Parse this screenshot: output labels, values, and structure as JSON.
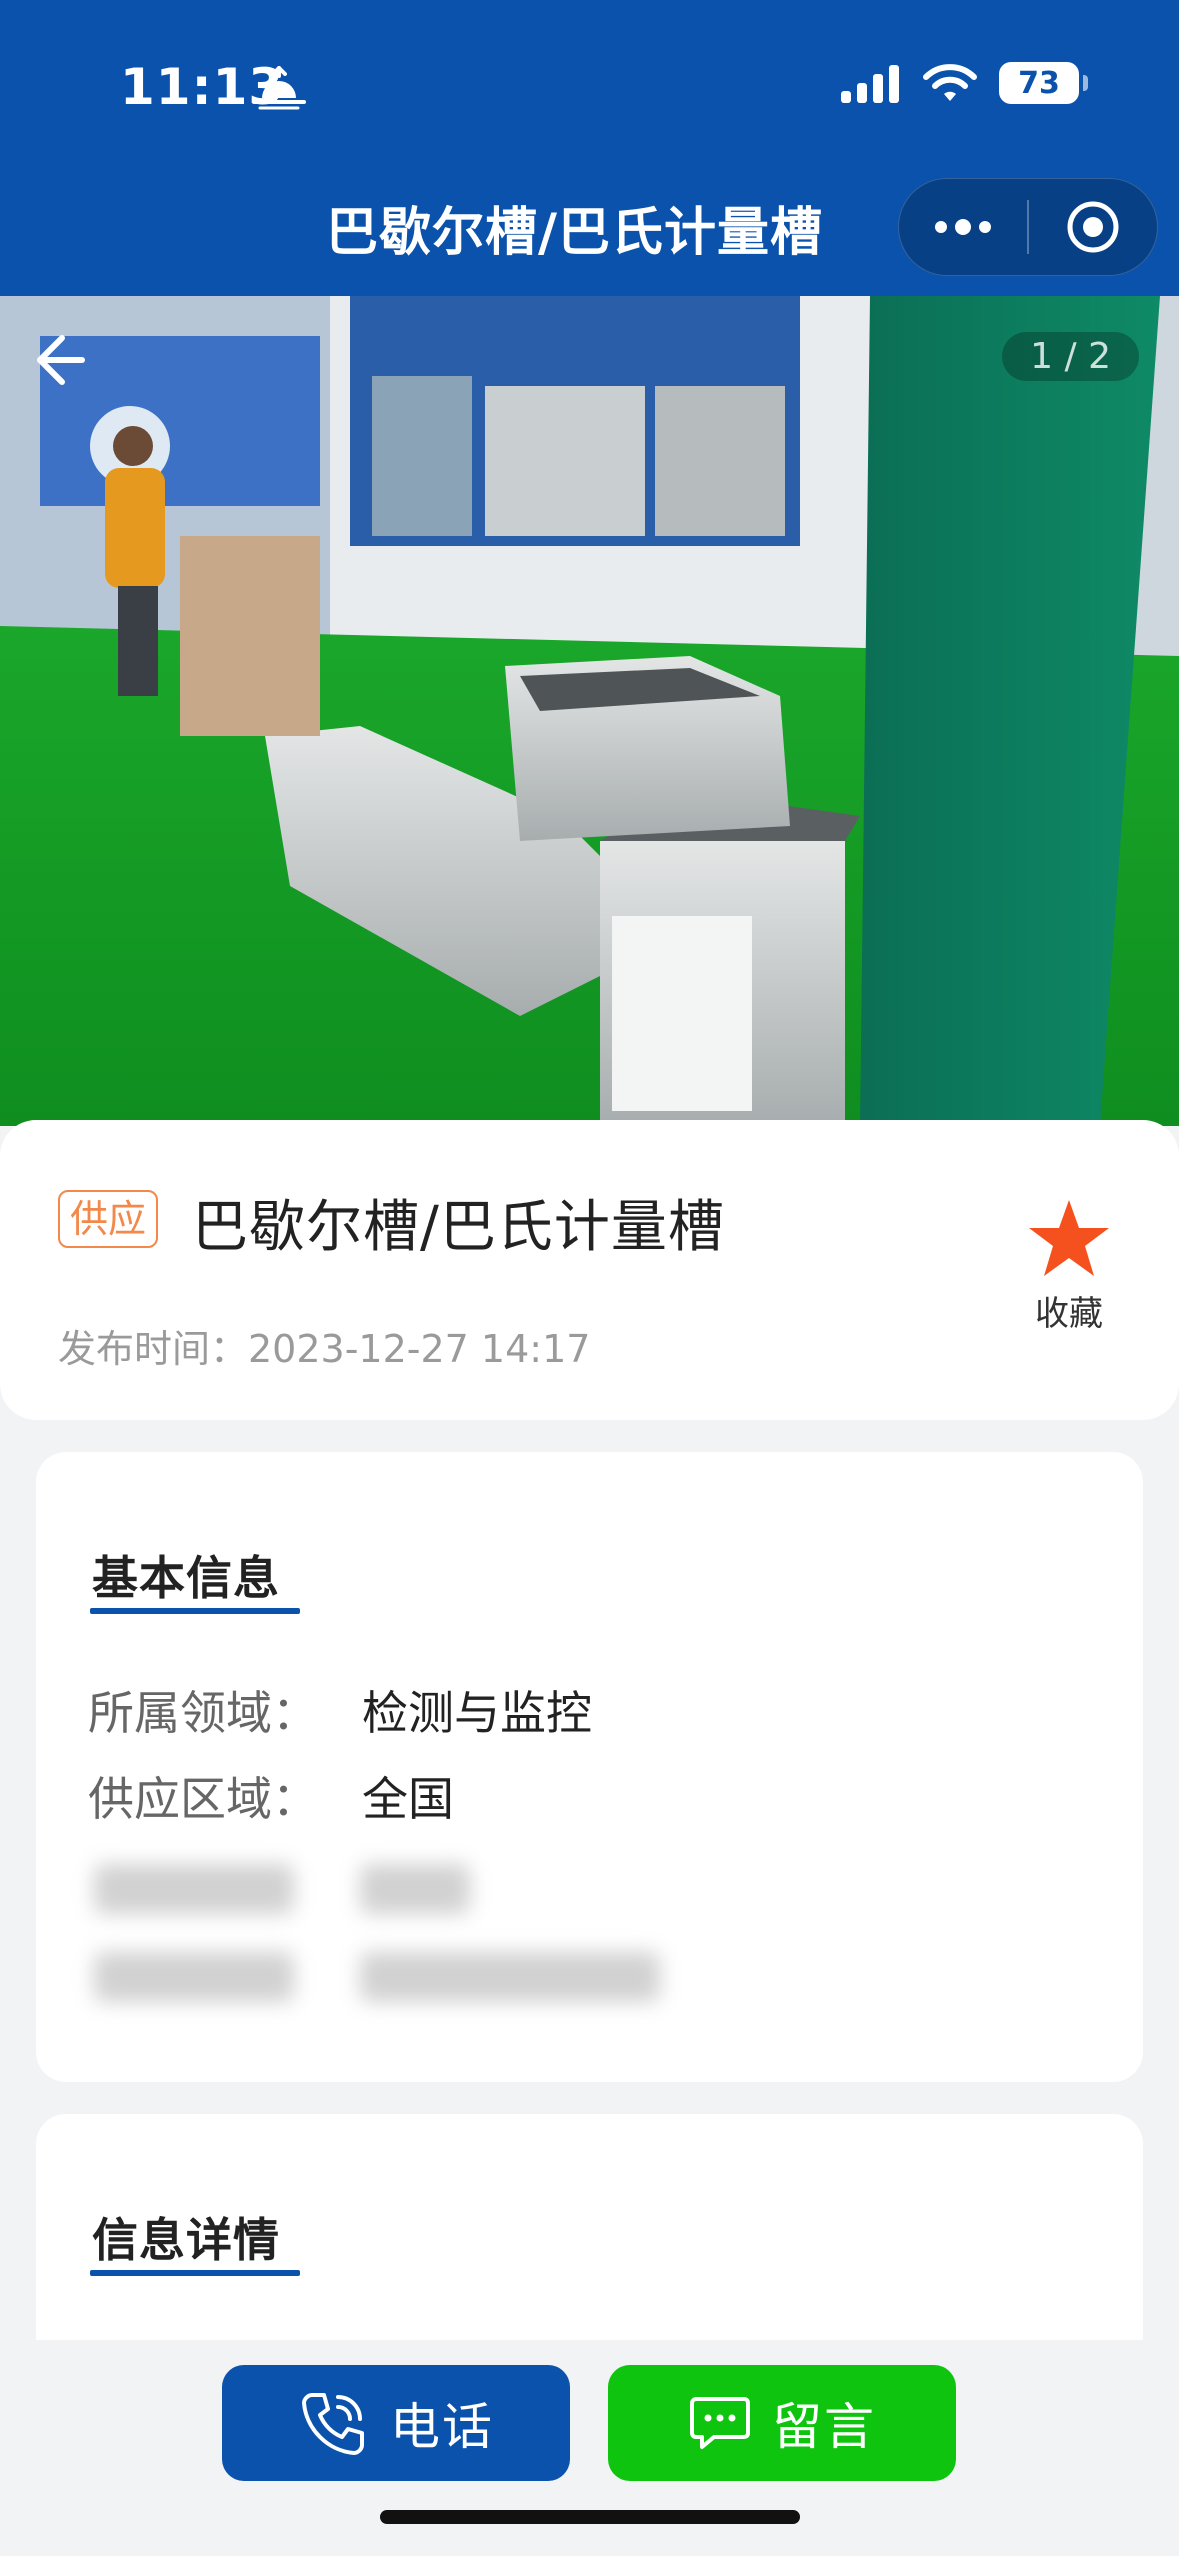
{
  "status_bar": {
    "time": "11:13",
    "battery": "73"
  },
  "nav": {
    "title": "巴歇尔槽/巴氏计量槽"
  },
  "gallery": {
    "page_indicator": "1 / 2"
  },
  "product": {
    "tag": "供应",
    "title": "巴歇尔槽/巴氏计量槽",
    "publish_time": "发布时间：2023-12-27 14:17",
    "favorite_label": "收藏"
  },
  "basic_info": {
    "section_title": "基本信息",
    "rows": [
      {
        "label": "所属领域：",
        "value": "检测与监控"
      },
      {
        "label": "供应区域：",
        "value": "全国"
      }
    ]
  },
  "detail": {
    "section_title": "信息详情"
  },
  "actions": {
    "phone_label": "电话",
    "message_label": "留言"
  },
  "colors": {
    "brand_blue": "#0a52ab",
    "action_green": "#0ec40e",
    "tag_orange": "#f2894a",
    "star_orange": "#f5511e"
  }
}
